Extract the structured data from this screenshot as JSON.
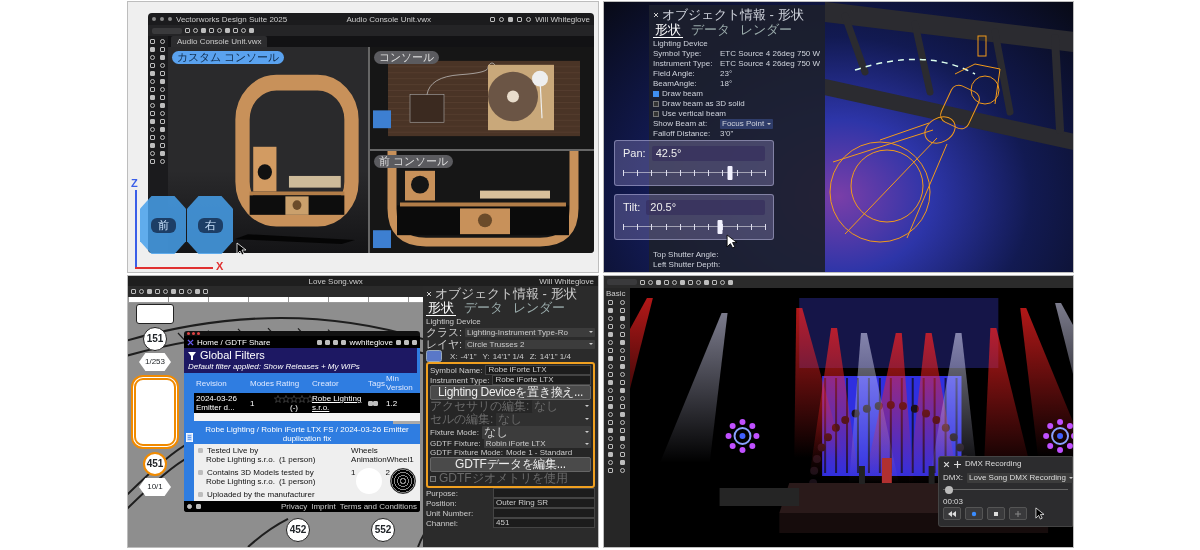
{
  "design_view": {
    "window": {
      "app": "Vectorworks Design Suite 2025",
      "file": "Audio Console Unit.vwx",
      "user": "Will Whiteglove"
    },
    "tab": "Audio Console Unit.vwx",
    "viewports": [
      {
        "label": "カスタム コンソール",
        "selected": true
      },
      {
        "label": "コンソール",
        "selected": false
      },
      {
        "label": "前 コンソール",
        "selected": false
      }
    ],
    "axes": {
      "z": "Z",
      "x": "X"
    },
    "view_cube": [
      "前",
      "右"
    ]
  },
  "lighting_view": {
    "panel": {
      "title": "オブジェクト情報 - 形状",
      "tabs": [
        {
          "label": "形状",
          "selected": true
        },
        {
          "label": "データ",
          "selected": false
        },
        {
          "label": "レンダー",
          "selected": false
        }
      ],
      "section": "Lighting Device",
      "fields": [
        {
          "label": "Symbol Type:",
          "value": "ETC Source 4 26deg 750 W"
        },
        {
          "label": "Instrument Type:",
          "value": "ETC Source 4 26deg 750 W"
        },
        {
          "label": "Field Angle:",
          "value": "23°"
        },
        {
          "label": "BeamAngle:",
          "value": "18°"
        }
      ],
      "checkboxes": [
        {
          "label": "Draw beam",
          "checked": true
        },
        {
          "label": "Draw beam as 3D solid",
          "checked": false
        },
        {
          "label": "Use vertical beam",
          "checked": false
        }
      ],
      "more_fields": [
        {
          "label": "Show Beam at:",
          "value": "Focus Point",
          "kind": "dropdown"
        },
        {
          "label": "Falloff Distance:",
          "value": "3'0\"",
          "kind": "text"
        }
      ],
      "lower_fields": [
        "Top Shutter Angle:",
        "Left Shutter Depth:"
      ]
    },
    "sliders": [
      {
        "label": "Pan:",
        "reading": "42.5°",
        "level": 0.75
      },
      {
        "label": "Tilt:",
        "reading": "20.5°",
        "level": 0.68
      }
    ]
  },
  "plot_view": {
    "window": {
      "file": "Love Song.vwx",
      "user": "Will Whiteglove"
    },
    "fixtures": [
      {
        "number": "151",
        "unit": "1/253",
        "selected": false
      },
      {
        "number": "451",
        "unit": "10/1",
        "selected": true
      },
      {
        "number": "452",
        "selected": false
      },
      {
        "number": "552",
        "selected": false
      }
    ],
    "gdtf": {
      "breadcrumb": "Home / GDTF Share",
      "user": "wwhiteglove",
      "filters_title": "Global Filters",
      "filter_note": "Default filter applied: Show Releases + My WIPs",
      "columns": [
        "Revision",
        "Modes",
        "Rating",
        "Creator",
        "Tags",
        "Min Version"
      ],
      "rows": [
        {
          "revision": "2024-03-26 Emitter d...",
          "modes": "1",
          "stars": 0,
          "rating_count": "(-)",
          "creator": "Robe Lighting s.r.o.",
          "min_version": "1.2",
          "selected": true
        }
      ],
      "detail_title": "Robe Lighting / Robin iForte LTX FS / 2024-03-26 Emitter duplication fix",
      "badges": [
        {
          "title": "Tested Live by",
          "by": "Robe Lighting s.r.o.",
          "count": "(1 person)"
        },
        {
          "title": "Contains 3D Models tested by",
          "by": "Robe Lighting s.r.o.",
          "count": "(1 person)"
        },
        {
          "title": "Uploaded by the manufacturer"
        }
      ],
      "wheels": {
        "title": "Wheels",
        "name": "AnimationWheel1",
        "slots": [
          {
            "number": "1",
            "kind": "open"
          },
          {
            "number": "2",
            "kind": "gobo"
          }
        ]
      },
      "footer_links": [
        "Privacy",
        "Imprint",
        "Terms and Conditions"
      ]
    },
    "object_info": {
      "title": "オブジェクト情報 - 形状",
      "tabs": [
        {
          "label": "形状",
          "selected": true
        },
        {
          "label": "データ",
          "selected": false
        },
        {
          "label": "レンダー",
          "selected": false
        }
      ],
      "section": "Lighting Device",
      "attributes": [
        {
          "label": "クラス:",
          "value": "Lighting-Instrument Type-Ro"
        },
        {
          "label": "レイヤ:",
          "value": "Circle Trusses 2"
        }
      ],
      "coords": [
        {
          "label": "X:",
          "value": "-4'1\""
        },
        {
          "label": "Y:",
          "value": "14'1\" 1/4"
        },
        {
          "label": "Z:",
          "value": "14'1\" 1/4"
        }
      ],
      "highlight": [
        {
          "kind": "field",
          "label": "Symbol Name:",
          "value": "Robe iForte LTX"
        },
        {
          "kind": "field",
          "label": "Instrument Type:",
          "value": "Robe iForte LTX"
        },
        {
          "kind": "button",
          "label": "Lighting Deviceを置き換え..."
        },
        {
          "kind": "dropdown",
          "label": "アクセサリの編集:",
          "value": "なし",
          "disabled": true
        },
        {
          "kind": "dropdown",
          "label": "セルの編集:",
          "value": "なし",
          "disabled": true
        },
        {
          "kind": "dropdown",
          "label": "Fixture Mode:",
          "value": "なし",
          "disabled": false
        },
        {
          "kind": "dropdown",
          "label": "GDTF Fixture:",
          "value": "Robin iForte LTX",
          "disabled": false
        },
        {
          "kind": "text",
          "label": "GDTF Fixture Mode:",
          "value": "Mode 1 - Standard"
        },
        {
          "kind": "button",
          "label": "GDTFデータを編集..."
        },
        {
          "kind": "checkbox",
          "label": "GDTFジオメトリを使用",
          "checked": false,
          "disabled": true
        }
      ],
      "lower": [
        {
          "label": "Purpose:"
        },
        {
          "label": "Position:",
          "value": "Outer Ring SR"
        },
        {
          "label": "Unit Number:"
        },
        {
          "label": "Channel:",
          "value": "451"
        }
      ]
    }
  },
  "stage_view": {
    "palette": "Basic",
    "dmx": {
      "title": "DMX Recording",
      "label": "DMX:",
      "value": "Love Song DMX Recording",
      "level": 0.05,
      "time": "00:03",
      "buttons": [
        {
          "kind": "rewind"
        },
        {
          "kind": "record"
        },
        {
          "kind": "stop"
        },
        {
          "kind": "add"
        }
      ]
    }
  }
}
